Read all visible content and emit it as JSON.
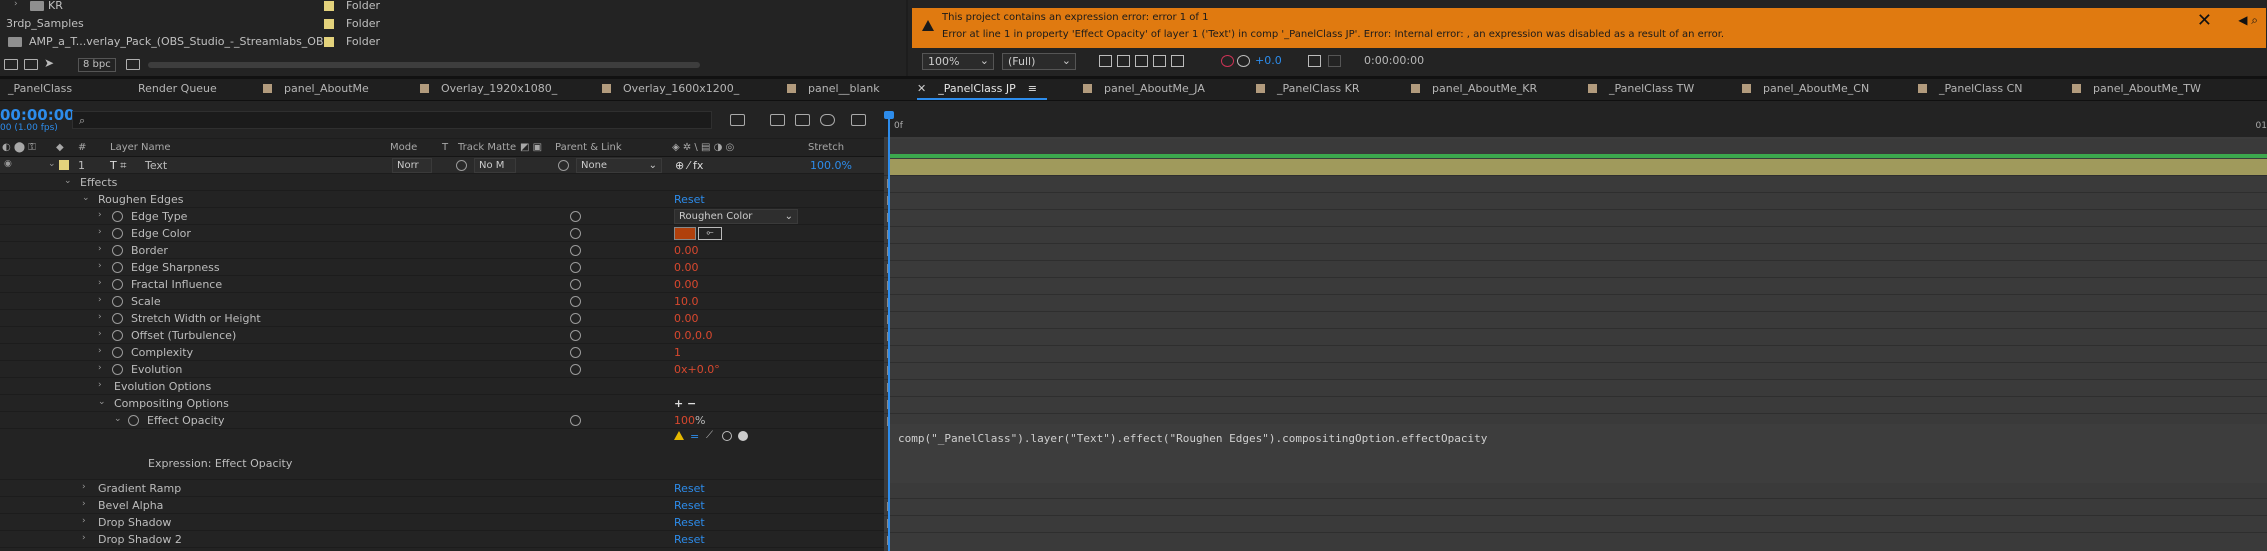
{
  "project": {
    "rows": [
      {
        "name": "KR",
        "type": "Folder"
      },
      {
        "name": "3rdp_Samples",
        "type": "Folder"
      },
      {
        "name": "AMP_a_T...verlay_Pack_(OBS_Studio_-_Streamlabs_OBS)",
        "type": "Folder"
      }
    ],
    "bpc": "8 bpc"
  },
  "error": {
    "line1": "This project contains an expression error: error 1 of 1",
    "line2": "Error at line 1 in property 'Effect Opacity' of layer 1 ('Text') in comp '_PanelClass JP'.  Error: Internal error: , an expression was disabled as a result of an error.",
    "close": "✕"
  },
  "viewer_toolbar": {
    "zoom": "100%",
    "resolution": "(Full)",
    "exposure": "+0.0",
    "timecode": "0:00:00:00"
  },
  "tabs": [
    {
      "label": "_PanelClass",
      "active": false
    },
    {
      "label": "Render Queue",
      "active": false
    },
    {
      "label": "panel_AboutMe",
      "active": false
    },
    {
      "label": "Overlay_1920x1080_",
      "active": false
    },
    {
      "label": "Overlay_1600x1200_",
      "active": false
    },
    {
      "label": "panel__blank",
      "active": false
    },
    {
      "label": "_PanelClass JP",
      "active": true
    },
    {
      "label": "panel_AboutMe_JA",
      "active": false
    },
    {
      "label": "_PanelClass KR",
      "active": false
    },
    {
      "label": "panel_AboutMe_KR",
      "active": false
    },
    {
      "label": "_PanelClass TW",
      "active": false
    },
    {
      "label": "panel_AboutMe_CN",
      "active": false
    },
    {
      "label": "_PanelClass CN",
      "active": false
    },
    {
      "label": "panel_AboutMe_TW",
      "active": false
    }
  ],
  "timeline": {
    "timecode": "00:00:00",
    "fps": "00 (1.00 fps)",
    "search_placeholder": "⌕",
    "columns": {
      "num": "#",
      "layer_name": "Layer Name",
      "mode": "Mode",
      "t": "T",
      "track_matte": "Track Matte",
      "parent": "Parent & Link",
      "stretch": "Stretch"
    },
    "layer": {
      "number": "1",
      "name": "Text",
      "mode": "Norr",
      "track_matte": "No M",
      "parent": "None",
      "stretch": "100.0%"
    },
    "ruler_start": "0f",
    "ruler_end": "01"
  },
  "tree": {
    "effects": "Effects",
    "roughen_edges": "Roughen Edges",
    "reset": "Reset",
    "edge_type": "Edge Type",
    "edge_type_value": "Roughen Color",
    "edge_color": "Edge Color",
    "edge_color_hex": "#b0400c",
    "border": "Border",
    "border_val": "0.00",
    "edge_sharpness": "Edge Sharpness",
    "edge_sharpness_val": "0.00",
    "fractal_influence": "Fractal Influence",
    "fractal_influence_val": "0.00",
    "scale": "Scale",
    "scale_val": "10.0",
    "stretch": "Stretch Width or Height",
    "stretch_val": "0.00",
    "offset": "Offset (Turbulence)",
    "offset_val": "0.0,0.0",
    "complexity": "Complexity",
    "complexity_val": "1",
    "evolution": "Evolution",
    "evolution_val_a": "0x",
    "evolution_val_b": "+0.0°",
    "evolution_options": "Evolution Options",
    "compositing_options": "Compositing Options",
    "plus_minus": "+ −",
    "effect_opacity": "Effect Opacity",
    "effect_opacity_val": "100",
    "effect_opacity_unit": "%",
    "expression_label": "Expression: Effect Opacity",
    "gradient_ramp": "Gradient Ramp",
    "bevel_alpha": "Bevel Alpha",
    "drop_shadow": "Drop Shadow",
    "drop_shadow_2": "Drop Shadow 2"
  },
  "expression": "comp(\"_PanelClass\").layer(\"Text\").effect(\"Roughen Edges\").compositingOption.effectOpacity"
}
